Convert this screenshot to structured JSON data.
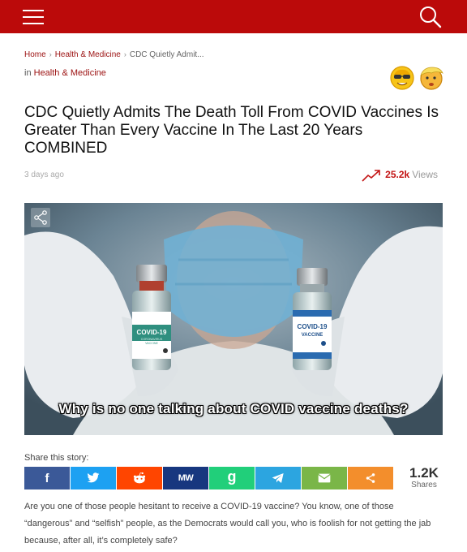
{
  "breadcrumb": {
    "home": "Home",
    "category": "Health & Medicine",
    "current": "CDC Quietly Admit..."
  },
  "category_line": {
    "prefix": "in",
    "category": "Health & Medicine"
  },
  "article": {
    "title": "CDC Quietly Admits The Death Toll From COVID Vaccines Is Greater Than Every Vaccine In The Last 20 Years COMBINED",
    "date": "3 days ago",
    "views_count": "25.2k",
    "views_label": "Views"
  },
  "hero": {
    "caption": "Why is no one talking about COVID vaccine deaths?",
    "vial_left": {
      "line1": "COVID-19",
      "line2": "CORONAVIRUS",
      "line3": "VACCINE"
    },
    "vial_right": {
      "line1": "COVID-19",
      "line2": "VACCINE"
    }
  },
  "share": {
    "title": "Share this story:",
    "buttons": [
      {
        "name": "facebook",
        "glyph": "f",
        "color": "#3b5998"
      },
      {
        "name": "twitter",
        "glyph": "",
        "color": "#1da1f2"
      },
      {
        "name": "reddit",
        "glyph": "",
        "color": "#ff4500"
      },
      {
        "name": "mewe",
        "glyph": "MW",
        "color": "#17377f"
      },
      {
        "name": "gab",
        "glyph": "g",
        "color": "#21cf7a"
      },
      {
        "name": "telegram",
        "glyph": "",
        "color": "#2ca5e0"
      },
      {
        "name": "email",
        "glyph": "",
        "color": "#7ab648"
      },
      {
        "name": "more",
        "glyph": "",
        "color": "#f38e2c"
      }
    ],
    "count": "1.2K",
    "count_label": "Shares"
  },
  "body": {
    "paragraph": "Are you one of those people hesitant to receive a COVID-19 vaccine? You know, one of those “dangerous” and “selfish” people, as the Democrats would call you, who is foolish for not getting the jab because, after all, it’s completely safe?"
  },
  "colors": {
    "header_red": "#bb0a0a",
    "link_red": "#9b1010",
    "views_red": "#c31313"
  }
}
